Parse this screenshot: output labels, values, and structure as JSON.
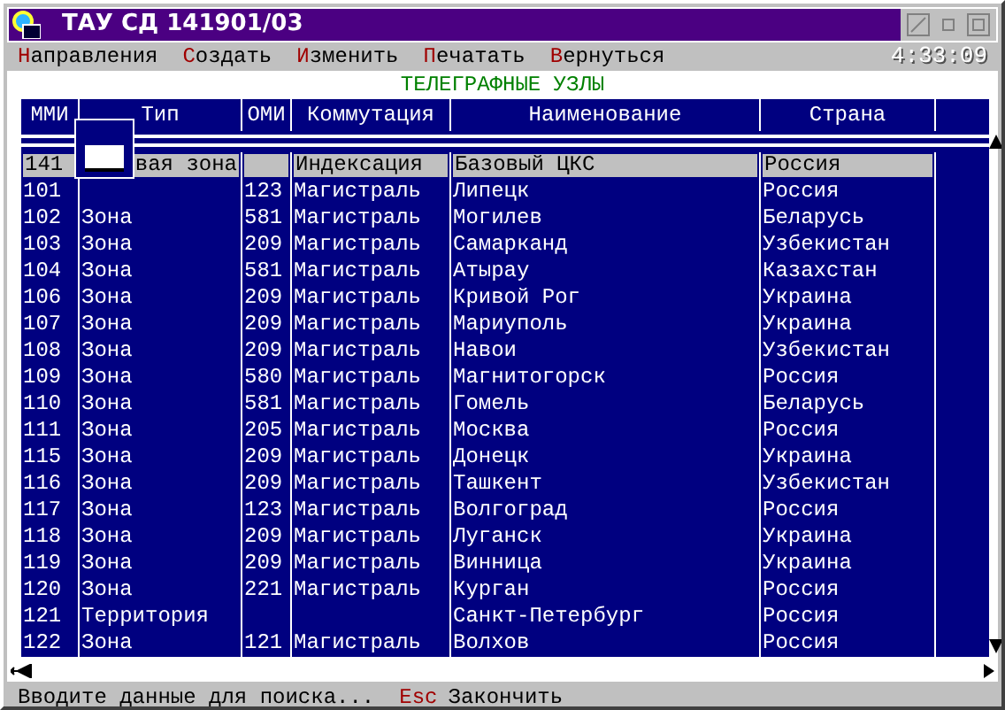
{
  "window": {
    "title": "ТАУ СД 141901/03"
  },
  "menu": [
    {
      "hotkey": "Н",
      "label": "аправления"
    },
    {
      "hotkey": "С",
      "label": "оздать"
    },
    {
      "hotkey": "И",
      "label": "зменить"
    },
    {
      "hotkey": "П",
      "label": "ечатать"
    },
    {
      "hotkey": "В",
      "label": "ернуться"
    }
  ],
  "clock": "4:33:09",
  "heading": "ТЕЛЕГРАФНЫЕ УЗЛЫ",
  "table": {
    "columns": [
      "ММИ",
      "Тип",
      "ОМИ",
      "Коммутация",
      "Наименование",
      "Страна"
    ],
    "rows": [
      {
        "selected": true,
        "cells": [
          "141",
          "вая зона",
          "",
          "Индексация",
          "Базовый ЦКС",
          "Россия"
        ]
      },
      {
        "selected": false,
        "cells": [
          "101",
          "",
          "123",
          "Магистраль",
          "Липецк",
          "Россия"
        ]
      },
      {
        "selected": false,
        "cells": [
          "102",
          "Зона",
          "581",
          "Магистраль",
          "Могилев",
          "Беларусь"
        ]
      },
      {
        "selected": false,
        "cells": [
          "103",
          "Зона",
          "209",
          "Магистраль",
          "Самарканд",
          "Узбекистан"
        ]
      },
      {
        "selected": false,
        "cells": [
          "104",
          "Зона",
          "581",
          "Магистраль",
          "Атырау",
          "Казахстан"
        ]
      },
      {
        "selected": false,
        "cells": [
          "106",
          "Зона",
          "209",
          "Магистраль",
          "Кривой Рог",
          "Украина"
        ]
      },
      {
        "selected": false,
        "cells": [
          "107",
          "Зона",
          "209",
          "Магистраль",
          "Мариуполь",
          "Украина"
        ]
      },
      {
        "selected": false,
        "cells": [
          "108",
          "Зона",
          "209",
          "Магистраль",
          "Навои",
          "Узбекистан"
        ]
      },
      {
        "selected": false,
        "cells": [
          "109",
          "Зона",
          "580",
          "Магистраль",
          "Магнитогорск",
          "Россия"
        ]
      },
      {
        "selected": false,
        "cells": [
          "110",
          "Зона",
          "581",
          "Магистраль",
          "Гомель",
          "Беларусь"
        ]
      },
      {
        "selected": false,
        "cells": [
          "111",
          "Зона",
          "205",
          "Магистраль",
          "Москва",
          "Россия"
        ]
      },
      {
        "selected": false,
        "cells": [
          "115",
          "Зона",
          "209",
          "Магистраль",
          "Донецк",
          "Украина"
        ]
      },
      {
        "selected": false,
        "cells": [
          "116",
          "Зона",
          "209",
          "Магистраль",
          "Ташкент",
          "Узбекистан"
        ]
      },
      {
        "selected": false,
        "cells": [
          "117",
          "Зона",
          "123",
          "Магистраль",
          "Волгоград",
          "Россия"
        ]
      },
      {
        "selected": false,
        "cells": [
          "118",
          "Зона",
          "209",
          "Магистраль",
          "Луганск",
          "Украина"
        ]
      },
      {
        "selected": false,
        "cells": [
          "119",
          "Зона",
          "209",
          "Магистраль",
          "Винница",
          "Украина"
        ]
      },
      {
        "selected": false,
        "cells": [
          "120",
          "Зона",
          "221",
          "Магистраль",
          "Курган",
          "Россия"
        ]
      },
      {
        "selected": false,
        "cells": [
          "121",
          "Территория",
          "",
          "",
          "Санкт-Петербург",
          "Россия"
        ]
      },
      {
        "selected": false,
        "cells": [
          "122",
          "Зона",
          "121",
          "Магистраль",
          "Волхов",
          "Россия"
        ]
      }
    ]
  },
  "status_bar": {
    "hint": "Вводите данные для поиска...",
    "key": "Esc",
    "action": "Закончить"
  }
}
